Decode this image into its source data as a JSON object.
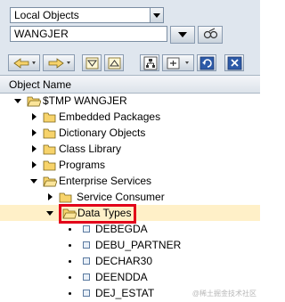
{
  "selector": {
    "object_type": "Local Objects",
    "user_value": "WANGJER"
  },
  "tree": {
    "column_header": "Object Name",
    "nodes": [
      {
        "label": "$TMP WANGJER",
        "state": "expanded"
      },
      {
        "label": "Embedded Packages",
        "state": "collapsed"
      },
      {
        "label": "Dictionary Objects",
        "state": "collapsed"
      },
      {
        "label": "Class Library",
        "state": "collapsed"
      },
      {
        "label": "Programs",
        "state": "collapsed"
      },
      {
        "label": "Enterprise Services",
        "state": "expanded"
      },
      {
        "label": "Service Consumer",
        "state": "collapsed"
      },
      {
        "label": "Data Types",
        "state": "expanded",
        "selected": true
      },
      {
        "label": "DEBEGDA"
      },
      {
        "label": "DEBU_PARTNER"
      },
      {
        "label": "DECHAR30"
      },
      {
        "label": "DEENDDA"
      },
      {
        "label": "DEJ_ESTAT"
      }
    ]
  },
  "toolbar": {
    "icons": [
      "back-arrow-icon",
      "forward-arrow-icon",
      "collapse-icon",
      "expand-icon",
      "hierarchy-icon",
      "display-object-icon",
      "refresh-icon",
      "close-icon"
    ]
  },
  "watermark": "@稀土掘金技术社区",
  "colors": {
    "highlight": "#fff0c8",
    "annotation": "#e2001a",
    "folder": "#f7d36b"
  }
}
